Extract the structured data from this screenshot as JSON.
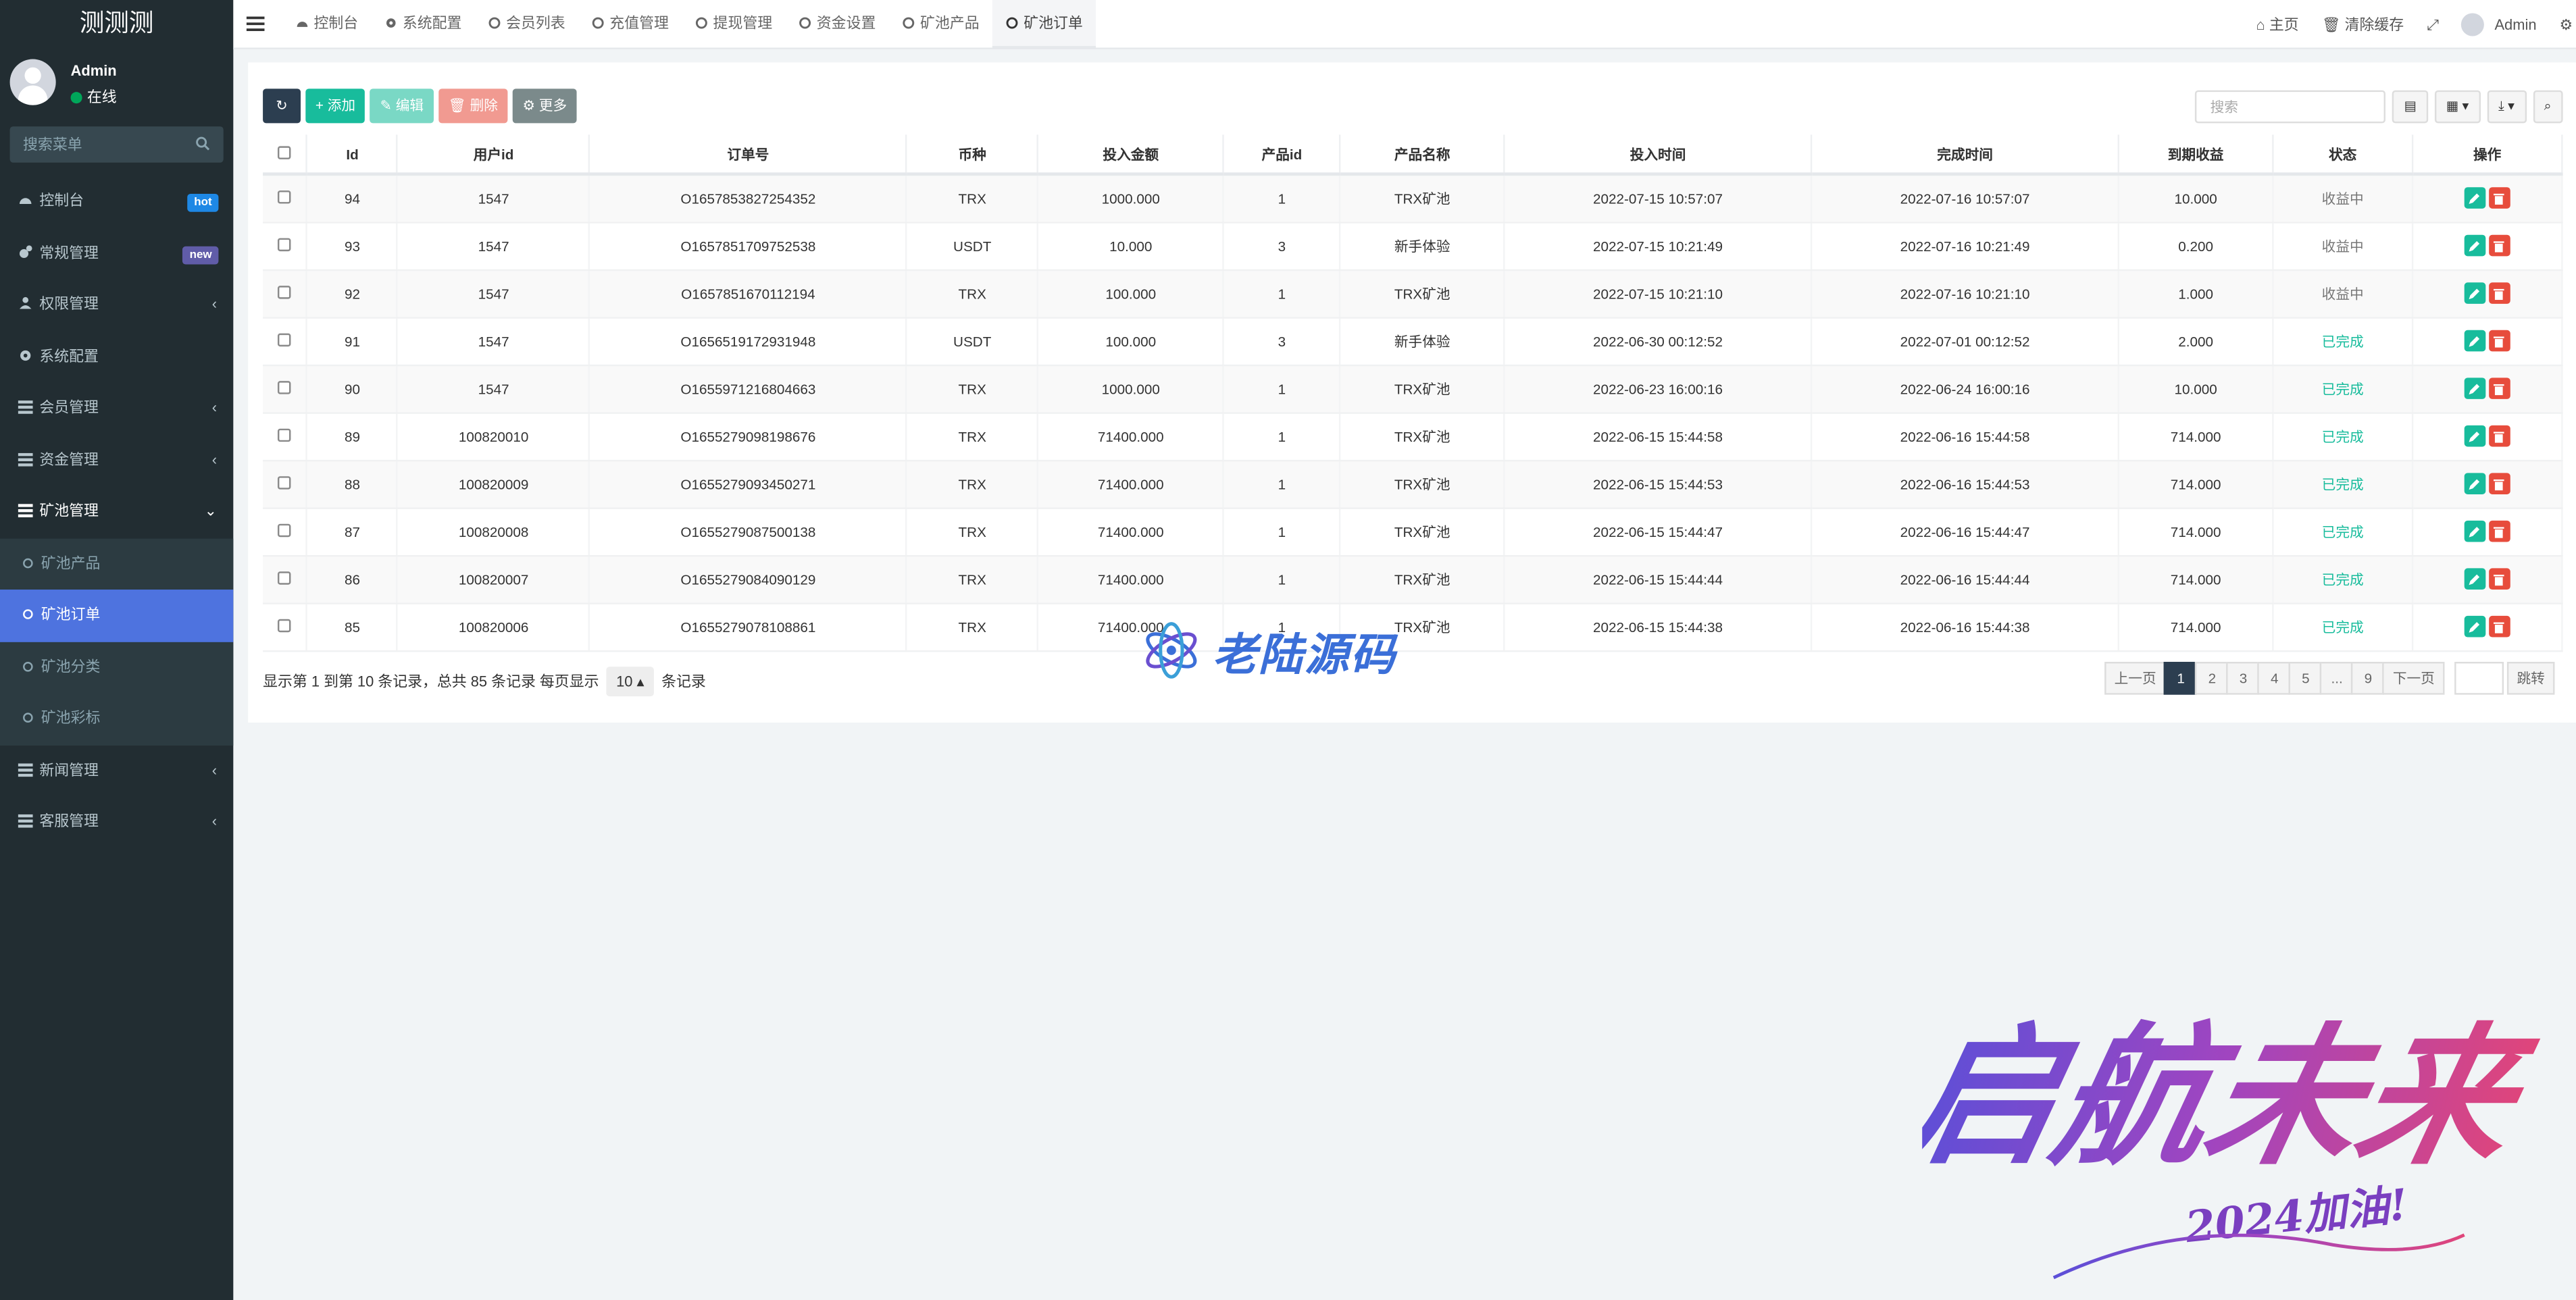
{
  "brand": "测测测",
  "user": {
    "name": "Admin",
    "status": "在线"
  },
  "sidebar_search": {
    "placeholder": "搜索菜单"
  },
  "menu": [
    {
      "label": "控制台",
      "icon": "dashboard-icon",
      "badge": "hot",
      "badge_color": "#1e88e5"
    },
    {
      "label": "常规管理",
      "icon": "cogs-icon",
      "badge": "new",
      "badge_color": "#605ca8"
    },
    {
      "label": "权限管理",
      "icon": "group-icon",
      "caret": "‹"
    },
    {
      "label": "系统配置",
      "icon": "gear-icon"
    },
    {
      "label": "会员管理",
      "icon": "list-icon",
      "caret": "‹"
    },
    {
      "label": "资金管理",
      "icon": "list-icon",
      "caret": "‹"
    },
    {
      "label": "矿池管理",
      "icon": "list-icon",
      "caret": "⌄"
    }
  ],
  "submenu": [
    {
      "label": "矿池产品"
    },
    {
      "label": "矿池订单"
    },
    {
      "label": "矿池分类"
    },
    {
      "label": "矿池彩标"
    }
  ],
  "menu_after": [
    {
      "label": "新闻管理",
      "caret": "‹"
    },
    {
      "label": "客服管理",
      "caret": "‹"
    }
  ],
  "tabs": [
    {
      "label": "控制台",
      "icon": "dashboard-icon"
    },
    {
      "label": "系统配置",
      "icon": "gear-icon"
    },
    {
      "label": "会员列表",
      "icon": "circle-icon"
    },
    {
      "label": "充值管理",
      "icon": "circle-icon"
    },
    {
      "label": "提现管理",
      "icon": "circle-icon"
    },
    {
      "label": "资金设置",
      "icon": "circle-icon"
    },
    {
      "label": "矿池产品",
      "icon": "circle-icon"
    },
    {
      "label": "矿池订单",
      "icon": "circle-icon"
    }
  ],
  "topright": {
    "home": "主页",
    "clear_cache": "清除缓存",
    "admin": "Admin"
  },
  "toolbar": {
    "add": "添加",
    "edit": "编辑",
    "delete": "删除",
    "more": "更多"
  },
  "search": {
    "placeholder": "搜索"
  },
  "table": {
    "headers": [
      "Id",
      "用户id",
      "订单号",
      "币种",
      "投入金额",
      "产品id",
      "产品名称",
      "投入时间",
      "完成时间",
      "到期收益",
      "状态",
      "操作"
    ],
    "rows": [
      [
        "94",
        "1547",
        "O1657853827254352",
        "TRX",
        "1000.000",
        "1",
        "TRX矿池",
        "2022-07-15 10:57:07",
        "2022-07-16 10:57:07",
        "10.000",
        "收益中"
      ],
      [
        "93",
        "1547",
        "O1657851709752538",
        "USDT",
        "10.000",
        "3",
        "新手体验",
        "2022-07-15 10:21:49",
        "2022-07-16 10:21:49",
        "0.200",
        "收益中"
      ],
      [
        "92",
        "1547",
        "O1657851670112194",
        "TRX",
        "100.000",
        "1",
        "TRX矿池",
        "2022-07-15 10:21:10",
        "2022-07-16 10:21:10",
        "1.000",
        "收益中"
      ],
      [
        "91",
        "1547",
        "O1656519172931948",
        "USDT",
        "100.000",
        "3",
        "新手体验",
        "2022-06-30 00:12:52",
        "2022-07-01 00:12:52",
        "2.000",
        "已完成"
      ],
      [
        "90",
        "1547",
        "O1655971216804663",
        "TRX",
        "1000.000",
        "1",
        "TRX矿池",
        "2022-06-23 16:00:16",
        "2022-06-24 16:00:16",
        "10.000",
        "已完成"
      ],
      [
        "89",
        "100820010",
        "O1655279098198676",
        "TRX",
        "71400.000",
        "1",
        "TRX矿池",
        "2022-06-15 15:44:58",
        "2022-06-16 15:44:58",
        "714.000",
        "已完成"
      ],
      [
        "88",
        "100820009",
        "O1655279093450271",
        "TRX",
        "71400.000",
        "1",
        "TRX矿池",
        "2022-06-15 15:44:53",
        "2022-06-16 15:44:53",
        "714.000",
        "已完成"
      ],
      [
        "87",
        "100820008",
        "O1655279087500138",
        "TRX",
        "71400.000",
        "1",
        "TRX矿池",
        "2022-06-15 15:44:47",
        "2022-06-16 15:44:47",
        "714.000",
        "已完成"
      ],
      [
        "86",
        "100820007",
        "O1655279084090129",
        "TRX",
        "71400.000",
        "1",
        "TRX矿池",
        "2022-06-15 15:44:44",
        "2022-06-16 15:44:44",
        "714.000",
        "已完成"
      ],
      [
        "85",
        "100820006",
        "O1655279078108861",
        "TRX",
        "71400.000",
        "1",
        "TRX矿池",
        "2022-06-15 15:44:38",
        "2022-06-16 15:44:38",
        "714.000",
        "已完成"
      ]
    ]
  },
  "pagination": {
    "info_prefix": "显示第 1 到第 10 条记录，总共 85 条记录 每页显示",
    "page_size": "10",
    "info_suffix": "条记录",
    "prev": "上一页",
    "pages": [
      "1",
      "2",
      "3",
      "4",
      "5",
      "...",
      "9"
    ],
    "next": "下一页",
    "jump": "跳转"
  },
  "watermarks": {
    "center": "老陆源码",
    "corner_main": "启航未来",
    "corner_sub": "2024加油!"
  },
  "colors": {
    "sidebar": "#222d32",
    "active": "#4e73df",
    "green": "#18bc9c",
    "red": "#e74c3c",
    "dark": "#2c3e50"
  }
}
